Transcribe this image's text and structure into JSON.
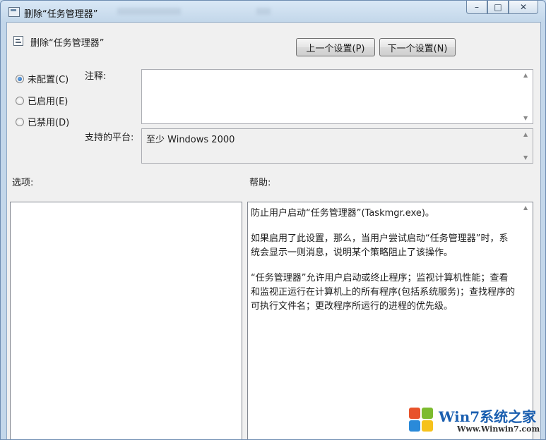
{
  "window": {
    "title": "删除“任务管理器”",
    "controls": {
      "minimize": "–",
      "maximize": "□",
      "close": "✕"
    }
  },
  "header": {
    "policy_name": "删除“任务管理器”",
    "prev_button": "上一个设置(P)",
    "next_button": "下一个设置(N)"
  },
  "state": {
    "options": [
      {
        "label": "未配置(C)",
        "checked": true
      },
      {
        "label": "已启用(E)",
        "checked": false
      },
      {
        "label": "已禁用(D)",
        "checked": false
      }
    ]
  },
  "comment": {
    "label": "注释:",
    "value": ""
  },
  "platform": {
    "label": "支持的平台:",
    "value": "至少 Windows 2000"
  },
  "options_panel": {
    "label": "选项:"
  },
  "help_panel": {
    "label": "帮助:",
    "lines": [
      "防止用户启动“任务管理器”(Taskmgr.exe)。",
      "",
      "如果启用了此设置，那么，当用户尝试启动“任务管理器”时，系",
      "统会显示一则消息，说明某个策略阻止了该操作。",
      "",
      "“任务管理器”允许用户启动或终止程序；监视计算机性能；查看",
      "和监视正运行在计算机上的所有程序(包括系统服务)；查找程序的",
      "可执行文件名；更改程序所运行的进程的优先级。"
    ]
  },
  "watermark": {
    "brand": "Win7系统之家",
    "url": "Www.Winwin7.com"
  },
  "colors": {
    "titlebar": "#c3d7ea",
    "client": "#f0f0f0",
    "textbox_border": "#abadb3",
    "watermark_blue": "#1b5fb0"
  }
}
